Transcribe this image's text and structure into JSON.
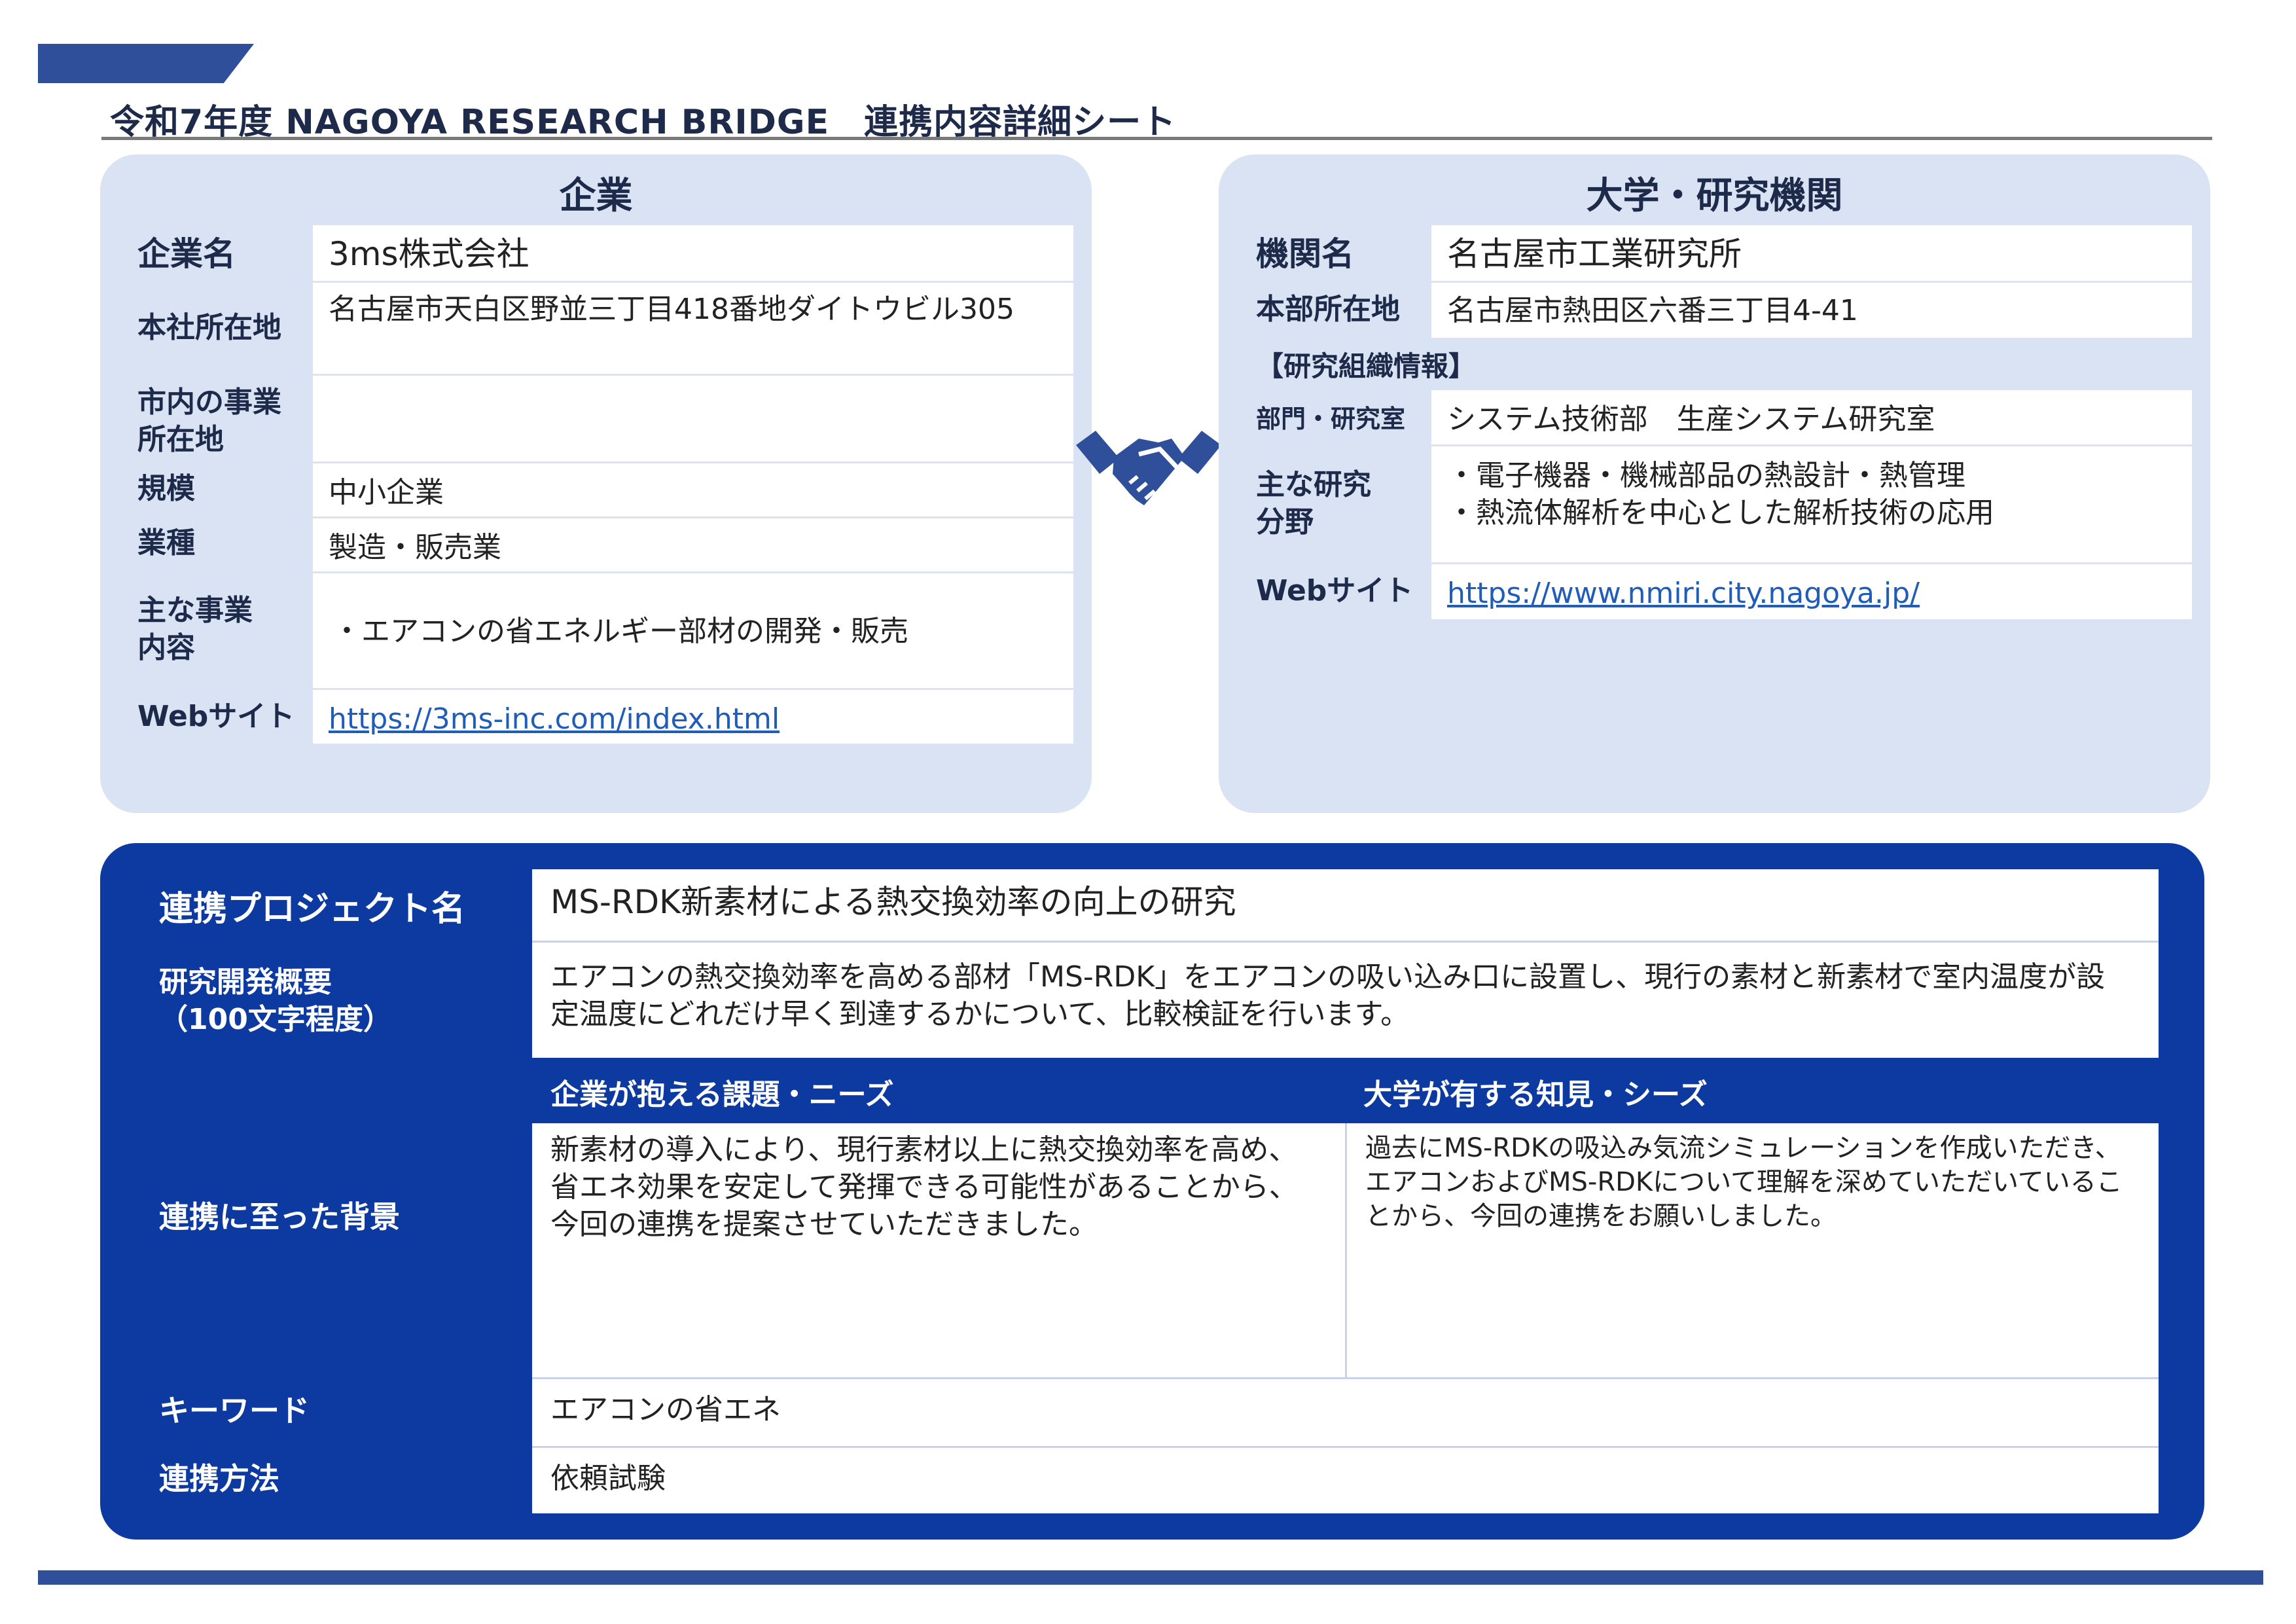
{
  "document": {
    "title": "令和7年度 NAGOYA RESEARCH BRIDGE　連携内容詳細シート"
  },
  "company": {
    "heading": "企業",
    "rows": [
      {
        "label": "企業名",
        "value": "3ms株式会社"
      },
      {
        "label": "本社所在地",
        "value": "名古屋市天白区野並三丁目418番地ダイトウビル305"
      },
      {
        "label": "市内の事業所在地",
        "value": ""
      },
      {
        "label": "規模",
        "value": "中小企業"
      },
      {
        "label": "業種",
        "value": "製造・販売業"
      },
      {
        "label": "主な事業内容",
        "value": "・エアコンの省エネルギー部材の開発・販売"
      },
      {
        "label": "Webサイト",
        "value": "https://3ms-inc.com/index.html"
      }
    ]
  },
  "university": {
    "heading": "大学・研究機関",
    "rows": [
      {
        "label": "機関名",
        "value": "名古屋市工業研究所"
      },
      {
        "label": "本部所在地",
        "value": "名古屋市熱田区六番三丁目4-41"
      }
    ],
    "research_org_label": "【研究組織情報】",
    "org_rows": [
      {
        "label": "部門・研究室",
        "value": "システム技術部　生産システム研究室"
      },
      {
        "label": "主な研究分野",
        "value_lines": [
          "・電子機器・機械部品の熱設計・熱管理",
          "・熱流体解析を中心とした解析技術の応用"
        ]
      },
      {
        "label": "Webサイト",
        "value": "https://www.nmiri.city.nagoya.jp/"
      }
    ]
  },
  "handshake_icon": "handshake-icon",
  "project": {
    "name_label": "連携プロジェクト名",
    "name_value": "MS-RDK新素材による熱交換効率の向上の研究",
    "summary_label_line1": "研究開発概要",
    "summary_label_line2": "（100文字程度）",
    "summary_value": "エアコンの熱交換効率を高める部材「MS-RDK」をエアコンの吸い込み口に設置し、現行の素材と新素材で室内温度が設定温度にどれだけ早く到達するかについて、比較検証を行います。",
    "background_label": "連携に至った背景",
    "needs_heading": "企業が抱える課題・ニーズ",
    "needs_text": "新素材の導入により、現行素材以上に熱交換効率を高め、省エネ効果を安定して発揮できる可能性があることから、今回の連携を提案させていただきました。",
    "seeds_heading": "大学が有する知見・シーズ",
    "seeds_text": "過去にMS-RDKの吸込み気流シミュレーションを作成いただき、エアコンおよびMS-RDKについて理解を深めていただいていることから、今回の連携をお願いしました。",
    "keyword_label": "キーワード",
    "keyword_value": "エアコンの省エネ",
    "method_label": "連携方法",
    "method_value": "依頼試験"
  },
  "colors": {
    "panel_bg": "#dae3f3",
    "project_bg": "#0d3aa1",
    "accent": "#2f4f9a",
    "link": "#1f5db8"
  }
}
